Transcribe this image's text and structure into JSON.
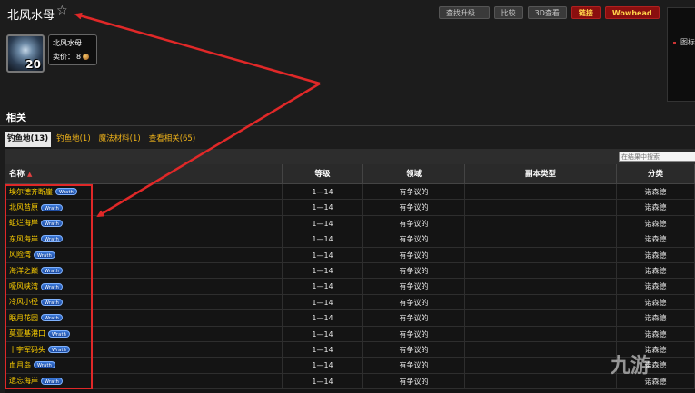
{
  "header": {
    "title": "北风水母",
    "star_icon": "star-outline-icon"
  },
  "toolbar": {
    "find_upgrade_label": "查找升级...",
    "compare_label": "比较",
    "view3d_label": "3D查看",
    "link_label": "链接",
    "wowhead_label": "Wowhead"
  },
  "side_panel": {
    "text": "图标"
  },
  "item": {
    "icon": "jellyfish-icon",
    "stack_count": "20",
    "name": "北风水母",
    "price_label": "卖价：",
    "price_value": "8",
    "price_icon": "copper-coin-icon"
  },
  "section": {
    "title": "相关"
  },
  "tabs": [
    {
      "label": "钓鱼地(13)",
      "active": true
    },
    {
      "label": "钓鱼地(1)"
    },
    {
      "label": "魔法材料(1)"
    },
    {
      "label": "查看相关(65)"
    }
  ],
  "table": {
    "search_placeholder": "在结果中搜索",
    "headers": {
      "name": "名称",
      "level": "等级",
      "territory": "领域",
      "instance_type": "副本类型",
      "category": "分类"
    },
    "badge_text": "Wrath",
    "rows": [
      {
        "name": "埃尔德齐断崖",
        "level": "1—14",
        "territory": "有争议的",
        "instance_type": "",
        "category": "诺森德"
      },
      {
        "name": "北风苔原",
        "level": "1—14",
        "territory": "有争议的",
        "instance_type": "",
        "category": "诺森德"
      },
      {
        "name": "蛆烂海岸",
        "level": "1—14",
        "territory": "有争议的",
        "instance_type": "",
        "category": "诺森德"
      },
      {
        "name": "东风海岸",
        "level": "1—14",
        "territory": "有争议的",
        "instance_type": "",
        "category": "诺森德"
      },
      {
        "name": "风险湾",
        "level": "1—14",
        "territory": "有争议的",
        "instance_type": "",
        "category": "诺森德"
      },
      {
        "name": "海洋之巅",
        "level": "1—14",
        "territory": "有争议的",
        "instance_type": "",
        "category": "诺森德"
      },
      {
        "name": "嚎风峡湾",
        "level": "1—14",
        "territory": "有争议的",
        "instance_type": "",
        "category": "诺森德"
      },
      {
        "name": "冷风小径",
        "level": "1—14",
        "territory": "有争议的",
        "instance_type": "",
        "category": "诺森德"
      },
      {
        "name": "眠月花园",
        "level": "1—14",
        "territory": "有争议的",
        "instance_type": "",
        "category": "诺森德"
      },
      {
        "name": "莫亚基港口",
        "level": "1—14",
        "territory": "有争议的",
        "instance_type": "",
        "category": "诺森德"
      },
      {
        "name": "十字军码头",
        "level": "1—14",
        "territory": "有争议的",
        "instance_type": "",
        "category": "诺森德"
      },
      {
        "name": "血月岛",
        "level": "1—14",
        "territory": "有争议的",
        "instance_type": "",
        "category": "诺森德"
      },
      {
        "name": "遗忘海岸",
        "level": "1—14",
        "territory": "有争议的",
        "instance_type": "",
        "category": "诺森德"
      }
    ]
  },
  "watermark": {
    "text": "九游"
  },
  "colors": {
    "annotation_red": "#e02828",
    "link_yellow": "#ffd100"
  }
}
